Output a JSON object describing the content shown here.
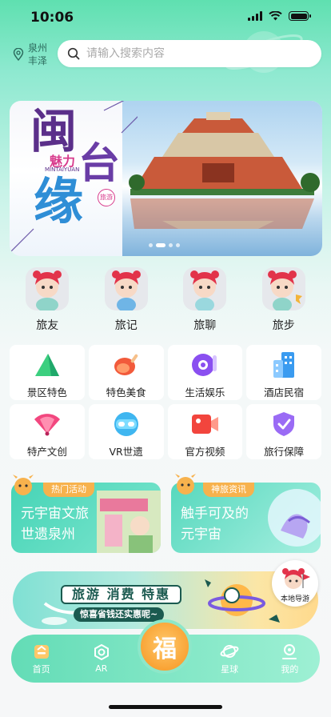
{
  "status_bar": {
    "time": "10:06"
  },
  "location": {
    "text": "泉州丰泽"
  },
  "search": {
    "placeholder": "请输入搜索内容"
  },
  "banner": {
    "title_chars": [
      "闽",
      "台",
      "缘"
    ],
    "sub": "魅力",
    "latin": "MINTAIYUAN",
    "tag": "旅游",
    "pager_total": 4,
    "pager_active": 1
  },
  "avatars": [
    {
      "label": "旅友"
    },
    {
      "label": "旅记"
    },
    {
      "label": "旅聊"
    },
    {
      "label": "旅步"
    }
  ],
  "grid": [
    {
      "label": "景区特色",
      "icon": "mountain-icon"
    },
    {
      "label": "特色美食",
      "icon": "drumstick-icon"
    },
    {
      "label": "生活娱乐",
      "icon": "music-disc-icon"
    },
    {
      "label": "酒店民宿",
      "icon": "hotel-icon"
    },
    {
      "label": "特产文创",
      "icon": "fan-icon"
    },
    {
      "label": "VR世遗",
      "icon": "vr-headset-icon"
    },
    {
      "label": "官方视频",
      "icon": "video-camera-icon"
    },
    {
      "label": "旅行保障",
      "icon": "shield-check-icon"
    }
  ],
  "promos": [
    {
      "tag": "热门活动",
      "title": "元宇宙文旅\n世遗泉州"
    },
    {
      "tag": "神旅资讯",
      "title": "触手可及的\n元宇宙"
    }
  ],
  "ad": {
    "line1": "旅游 消费 特惠",
    "line2": "惊喜省钱还实惠呢~"
  },
  "local_guide": {
    "label": "本地导游"
  },
  "tabbar": {
    "home": "首页",
    "ar": "AR",
    "center": "福",
    "planet": "星球",
    "mine": "我的"
  },
  "colors": {
    "accent": "#5fdcb3",
    "tag_orange": "#f7b24d"
  }
}
